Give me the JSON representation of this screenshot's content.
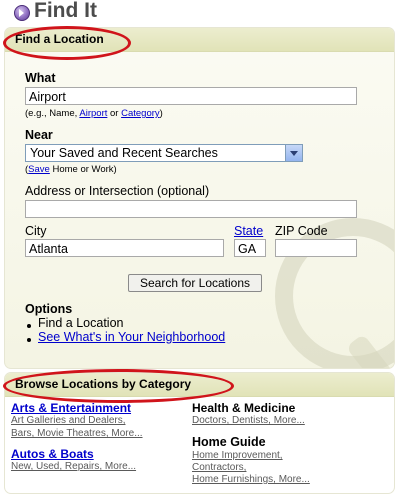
{
  "header": {
    "title": "Find It",
    "icon": "play-circle-icon"
  },
  "find_location": {
    "section_title": "Find a Location",
    "what": {
      "label": "What",
      "value": "Airport",
      "hint_prefix": "(e.g., Name, ",
      "hint_link1": "Airport",
      "hint_mid": " or ",
      "hint_link2": "Category",
      "hint_suffix": ")"
    },
    "near": {
      "label": "Near",
      "selected": "Your Saved and Recent Searches",
      "hint_prefix": "(",
      "hint_link": "Save",
      "hint_suffix": " Home or Work)"
    },
    "address": {
      "label": "Address or Intersection (optional)",
      "value": ""
    },
    "city": {
      "label": "City",
      "value": "Atlanta"
    },
    "state": {
      "label": "State",
      "value": "GA"
    },
    "zip": {
      "label": "ZIP Code",
      "value": ""
    },
    "search_button": "Search for Locations",
    "options": {
      "title": "Options",
      "items": [
        {
          "text": "Find a Location",
          "is_link": false
        },
        {
          "text": "See What's in Your Neighborhood",
          "is_link": true
        }
      ]
    }
  },
  "browse": {
    "section_title": "Browse Locations by Category",
    "categories": [
      {
        "title": "Arts & Entertainment",
        "sub1": "Art Galleries and Dealers,",
        "sub2": "Bars, Movie Theatres, More..."
      },
      {
        "title": "Autos & Boats",
        "sub1": "New, Used, Repairs, More...",
        "sub2": ""
      },
      {
        "title": "Health & Medicine",
        "sub1": "Doctors, Dentists, More...",
        "sub2": ""
      },
      {
        "title": "Home Guide",
        "sub1": "Home Improvement,",
        "sub2": "Contractors,",
        "sub3": "Home Furnishings, More..."
      }
    ]
  },
  "colors": {
    "annotation_oval": "#d0141b",
    "link": "#0000cc",
    "panel_head": "#e1e3b8"
  }
}
